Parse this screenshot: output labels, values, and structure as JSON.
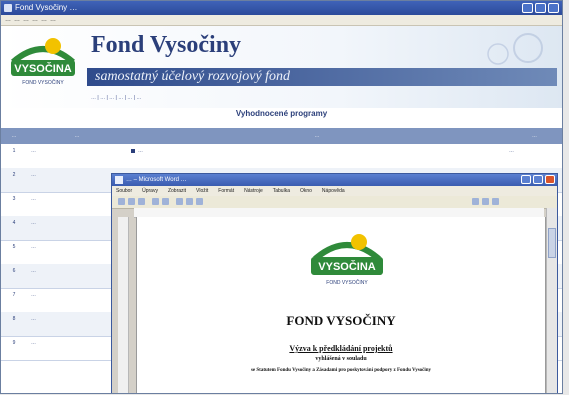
{
  "browser": {
    "title": "Fond Vysočiny …",
    "menu": [
      "…",
      "…",
      "…",
      "…",
      "…",
      "…"
    ]
  },
  "site": {
    "title": "Fond Vysočiny",
    "slogan": "samostatný účelový rozvojový fond",
    "logo_text": "VYSOČINA",
    "logo_subtext": "FOND VYSOČINY",
    "nav_links": "… | … | … | … | … | …",
    "section_heading": "Vyhodnocené programy"
  },
  "table": {
    "headers": [
      "…",
      "…",
      "…",
      "…"
    ],
    "rows": [
      {
        "num": "1",
        "name": "…",
        "detail": "…",
        "date": "…"
      },
      {
        "num": "2",
        "name": "…",
        "detail": "",
        "date": ""
      },
      {
        "num": "3",
        "name": "…",
        "detail": "",
        "date": ""
      },
      {
        "num": "4",
        "name": "…",
        "detail": "",
        "date": ""
      },
      {
        "num": "5",
        "name": "…",
        "detail": "",
        "date": ""
      },
      {
        "num": "6",
        "name": "…",
        "detail": "",
        "date": ""
      },
      {
        "num": "7",
        "name": "…",
        "detail": "",
        "date": ""
      },
      {
        "num": "8",
        "name": "…",
        "detail": "",
        "date": ""
      },
      {
        "num": "9",
        "name": "…",
        "detail": "",
        "date": ""
      }
    ]
  },
  "word": {
    "title": "… – Microsoft Word …",
    "menu": [
      "Soubor",
      "Úpravy",
      "Zobrazit",
      "Vložit",
      "Formát",
      "Nástroje",
      "Tabulka",
      "Okno",
      "Nápověda"
    ],
    "doc": {
      "logo_text": "VYSOČINA",
      "logo_subtext": "FOND VYSOČINY",
      "title": "FOND VYSOČINY",
      "heading": "Výzva k předkládání projektů",
      "subheading": "vyhlášená v souladu",
      "line": "se Statutem Fondu Vysočiny a Zásadami pro poskytování podpory z Fondu Vysočiny"
    }
  },
  "colors": {
    "primary": "#2b3f7a",
    "accent_green": "#2f8a3a",
    "accent_yellow": "#f2c200"
  }
}
